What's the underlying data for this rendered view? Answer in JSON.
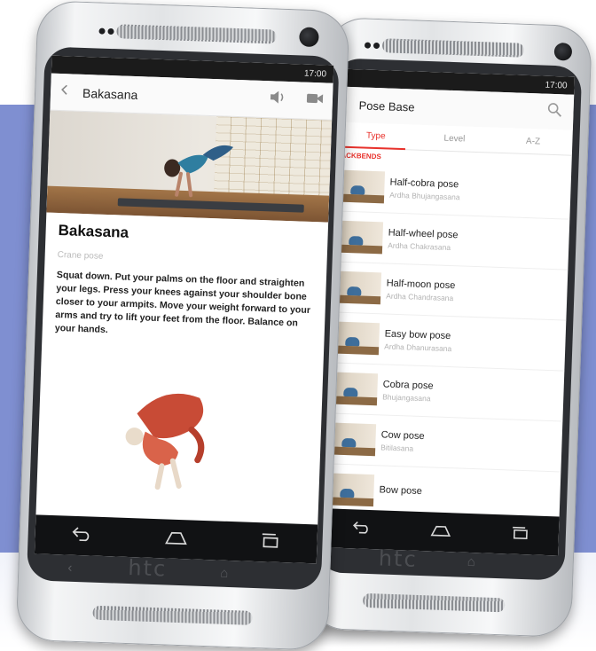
{
  "left_phone": {
    "status_time": "17:00",
    "header": {
      "back_icon": "chevron-left-icon",
      "title": "Bakasana",
      "audio_icon": "speaker-icon",
      "video_icon": "video-camera-icon"
    },
    "pose_title": "Bakasana",
    "pose_english": "Crane pose",
    "description": "Squat down. Put your palms on the floor and straighten your legs. Press your knees against your shoulder bone closer to your armpits. Move your weight forward to your arms and try to lift your feet from the floor. Balance on your hands.",
    "brand": "htc"
  },
  "right_phone": {
    "status_time": "17:00",
    "header": {
      "title": "Pose Base",
      "search_icon": "search-icon"
    },
    "tabs": [
      {
        "label": "Type"
      },
      {
        "label": "Level"
      },
      {
        "label": "A-Z"
      }
    ],
    "active_tab": "Type",
    "section": "BACKBENDS",
    "poses": [
      {
        "name": "Half-cobra pose",
        "sanskrit": "Ardha Bhujangasana"
      },
      {
        "name": "Half-wheel pose",
        "sanskrit": "Ardha Chakrasana"
      },
      {
        "name": "Half-moon pose",
        "sanskrit": "Ardha Chandrasana"
      },
      {
        "name": "Easy bow pose",
        "sanskrit": "Ardha Dhanurasana"
      },
      {
        "name": "Cobra pose",
        "sanskrit": "Bhujangasana"
      },
      {
        "name": "Cow pose",
        "sanskrit": "Bitilasana"
      },
      {
        "name": "Bow pose",
        "sanskrit": ""
      }
    ],
    "brand": "htc"
  },
  "colors": {
    "accent": "#e8322c",
    "background_panel": "#7f8fd1"
  }
}
